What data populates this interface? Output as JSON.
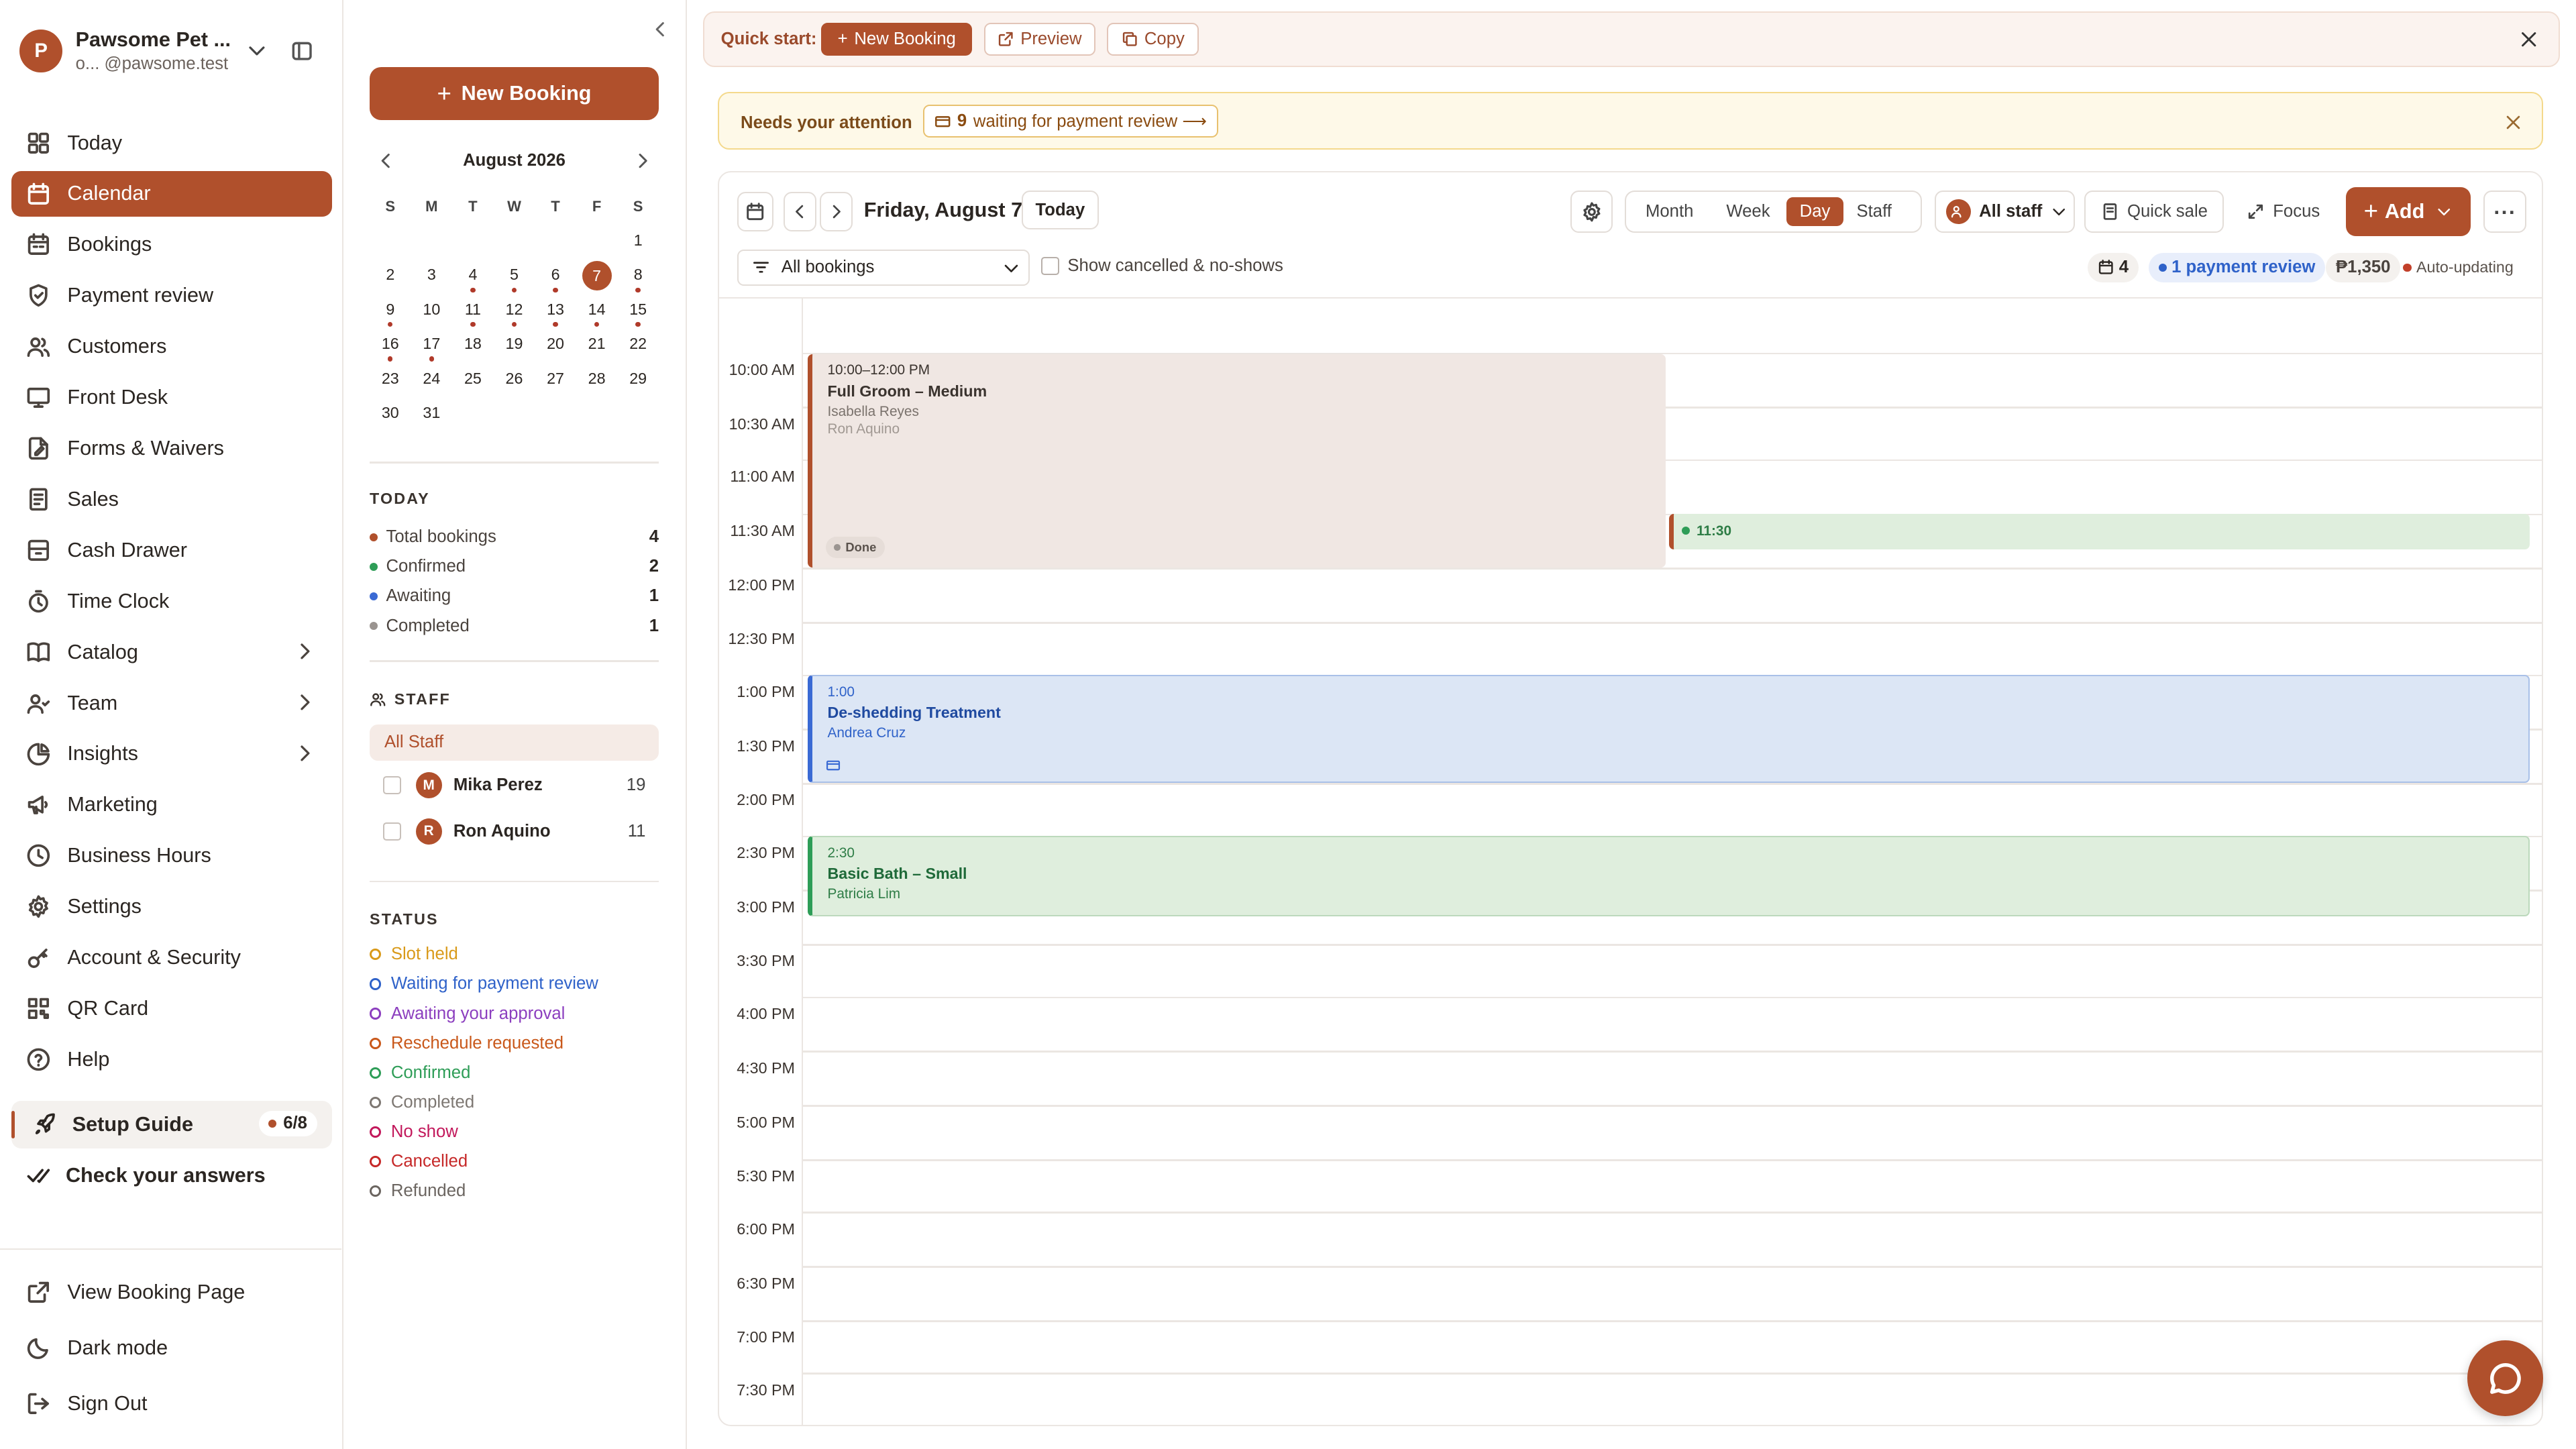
{
  "brand": {
    "name": "Pawsome Pet ...",
    "sub": "o...  @pawsome.test",
    "initial": "P"
  },
  "nav": [
    {
      "label": "Today",
      "icon": "grid-icon"
    },
    {
      "label": "Calendar",
      "icon": "calendar-icon",
      "active": true
    },
    {
      "label": "Bookings",
      "icon": "bookings-icon"
    },
    {
      "label": "Payment review",
      "icon": "shield-icon"
    },
    {
      "label": "Customers",
      "icon": "users-icon"
    },
    {
      "label": "Front Desk",
      "icon": "monitor-icon"
    },
    {
      "label": "Forms & Waivers",
      "icon": "form-icon"
    },
    {
      "label": "Sales",
      "icon": "receipt-icon"
    },
    {
      "label": "Cash Drawer",
      "icon": "drawer-icon"
    },
    {
      "label": "Time Clock",
      "icon": "timer-icon"
    },
    {
      "label": "Catalog",
      "icon": "book-icon",
      "arrow": true
    },
    {
      "label": "Team",
      "icon": "team-icon",
      "arrow": true
    },
    {
      "label": "Insights",
      "icon": "pie-icon",
      "arrow": true
    },
    {
      "label": "Marketing",
      "icon": "megaphone-icon"
    },
    {
      "label": "Business Hours",
      "icon": "clock-icon"
    },
    {
      "label": "Settings",
      "icon": "gear-icon"
    },
    {
      "label": "Account & Security",
      "icon": "key-icon"
    },
    {
      "label": "QR Card",
      "icon": "qr-icon"
    },
    {
      "label": "Help",
      "icon": "help-icon"
    }
  ],
  "setup": {
    "label": "Setup Guide",
    "progress": "6/8"
  },
  "check": {
    "label": "Check your answers"
  },
  "bottom": {
    "view": "View Booking Page",
    "dark": "Dark mode",
    "signout": "Sign Out"
  },
  "mid": {
    "new_booking": "New Booking",
    "month_title": "August 2026",
    "dow": [
      "S",
      "M",
      "T",
      "W",
      "T",
      "F",
      "S"
    ],
    "weeks": [
      [
        "",
        "",
        "",
        "",
        "",
        "",
        "1"
      ],
      [
        "2",
        "3",
        "4",
        "5",
        "6",
        "7",
        "8"
      ],
      [
        "9",
        "10",
        "11",
        "12",
        "13",
        "14",
        "15"
      ],
      [
        "16",
        "17",
        "18",
        "19",
        "20",
        "21",
        "22"
      ],
      [
        "23",
        "24",
        "25",
        "26",
        "27",
        "28",
        "29"
      ],
      [
        "30",
        "31",
        "",
        "",
        "",
        "",
        ""
      ]
    ],
    "dot_days": [
      "4",
      "5",
      "6",
      "8",
      "9",
      "11",
      "12",
      "13",
      "14",
      "15",
      "16",
      "17"
    ],
    "selected_day": "7",
    "today_title": "TODAY",
    "today_stats": [
      {
        "label": "Total bookings",
        "value": "4",
        "color": "#b0502c"
      },
      {
        "label": "Confirmed",
        "value": "2",
        "color": "#2e9d57"
      },
      {
        "label": "Awaiting",
        "value": "1",
        "color": "#3a6ad4"
      },
      {
        "label": "Completed",
        "value": "1",
        "color": "#9a9490"
      }
    ],
    "staff_title": "STAFF",
    "all_staff": "All Staff",
    "staff": [
      {
        "initial": "M",
        "name": "Mika Perez",
        "count": "19"
      },
      {
        "initial": "R",
        "name": "Ron Aquino",
        "count": "11"
      }
    ],
    "status_title": "STATUS",
    "statuses": [
      {
        "label": "Slot held",
        "color": "#d99a1a"
      },
      {
        "label": "Waiting for payment review",
        "color": "#2f62c9"
      },
      {
        "label": "Awaiting your approval",
        "color": "#8c3fbf"
      },
      {
        "label": "Reschedule requested",
        "color": "#c9581a"
      },
      {
        "label": "Confirmed",
        "color": "#2e9d57"
      },
      {
        "label": "Completed",
        "color": "#7d7772"
      },
      {
        "label": "No show",
        "color": "#c2185b"
      },
      {
        "label": "Cancelled",
        "color": "#c62828"
      },
      {
        "label": "Refunded",
        "color": "#6b6560"
      }
    ]
  },
  "quick": {
    "label": "Quick start:",
    "new": "New Booking",
    "preview": "Preview",
    "copy": "Copy"
  },
  "attention": {
    "label": "Needs your attention",
    "count": "9",
    "text": "waiting for payment review ⟶"
  },
  "toolbar": {
    "date": "Friday, August 7",
    "today": "Today",
    "views": [
      "Month",
      "Week",
      "Day",
      "Staff"
    ],
    "active_view": "Day",
    "staff": "All staff",
    "quick_sale": "Quick sale",
    "focus": "Focus",
    "add": "Add",
    "filter": "All bookings",
    "show_cancelled": "Show cancelled & no-shows",
    "count": "4",
    "payment_review": "1 payment review",
    "revenue": "₱1,350",
    "auto": "Auto-updating"
  },
  "hours": [
    "10:00 AM",
    "10:30 AM",
    "11:00 AM",
    "11:30 AM",
    "12:00 PM",
    "12:30 PM",
    "1:00 PM",
    "1:30 PM",
    "2:00 PM",
    "2:30 PM",
    "3:00 PM",
    "3:30 PM",
    "4:00 PM",
    "4:30 PM",
    "5:00 PM",
    "5:30 PM",
    "6:00 PM",
    "6:30 PM",
    "7:00 PM",
    "7:30 PM"
  ],
  "events": [
    {
      "time": "10:00–12:00 PM",
      "service": "Full Groom – Medium",
      "customer": "Isabella Reyes",
      "staff": "Ron Aquino",
      "status": "Done"
    },
    {
      "time": "11:30"
    },
    {
      "time": "1:00",
      "service": "De-shedding Treatment",
      "customer": "Andrea Cruz"
    },
    {
      "time": "2:30",
      "service": "Basic Bath – Small",
      "customer": "Patricia Lim"
    }
  ]
}
